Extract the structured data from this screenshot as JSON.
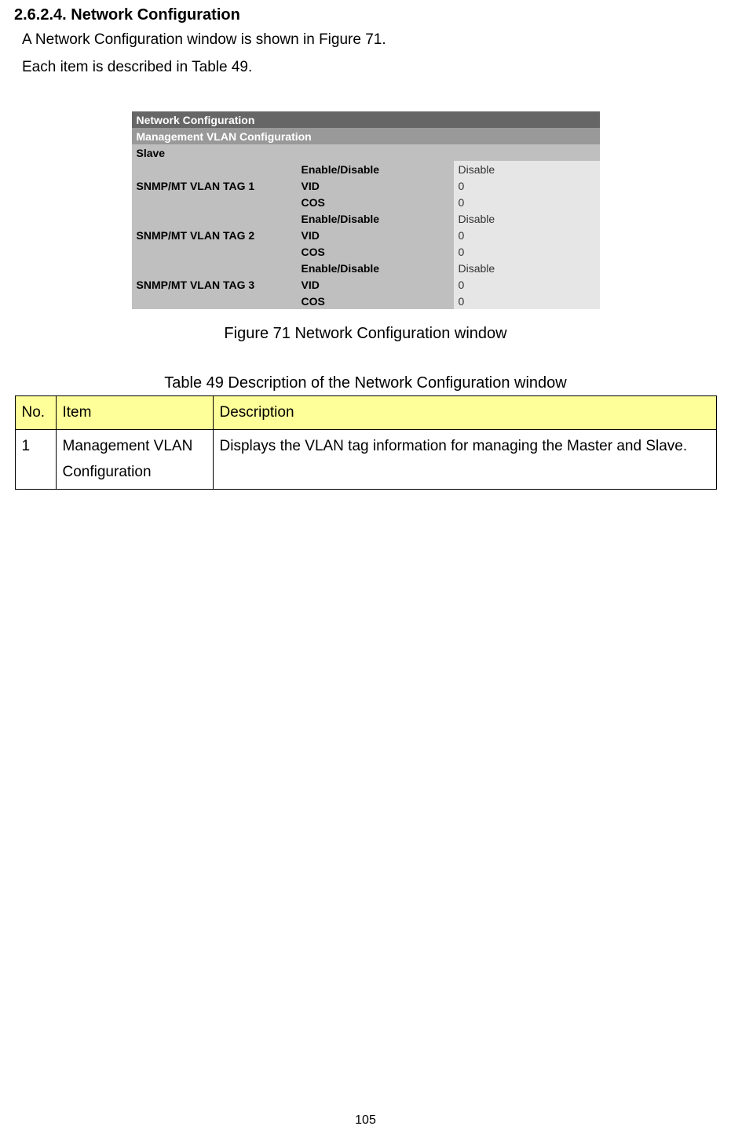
{
  "heading": "2.6.2.4. Network Configuration",
  "para1": "A Network Configuration window is shown in Figure 71.",
  "para2": "Each item is described in Table 49.",
  "figure": {
    "title": "Network Configuration",
    "subtitle": "Management VLAN Configuration",
    "slave": "Slave",
    "tags": [
      {
        "name": "SNMP/MT VLAN TAG 1",
        "rows": [
          {
            "label": "Enable/Disable",
            "value": "Disable"
          },
          {
            "label": "VID",
            "value": "0"
          },
          {
            "label": "COS",
            "value": "0"
          }
        ]
      },
      {
        "name": "SNMP/MT VLAN TAG 2",
        "rows": [
          {
            "label": "Enable/Disable",
            "value": "Disable"
          },
          {
            "label": "VID",
            "value": "0"
          },
          {
            "label": "COS",
            "value": "0"
          }
        ]
      },
      {
        "name": "SNMP/MT VLAN TAG 3",
        "rows": [
          {
            "label": "Enable/Disable",
            "value": "Disable"
          },
          {
            "label": "VID",
            "value": "0"
          },
          {
            "label": "COS",
            "value": "0"
          }
        ]
      }
    ]
  },
  "figureCaption": "Figure 71 Network Configuration window",
  "tableCaption": "Table 49 Description of the Network Configuration window",
  "descTable": {
    "headers": {
      "no": "No.",
      "item": "Item",
      "desc": "Description"
    },
    "rows": [
      {
        "no": "1",
        "item": "Management VLAN Configuration",
        "desc": "Displays the VLAN tag information for managing the Master and Slave."
      }
    ]
  },
  "pageNumber": "105"
}
